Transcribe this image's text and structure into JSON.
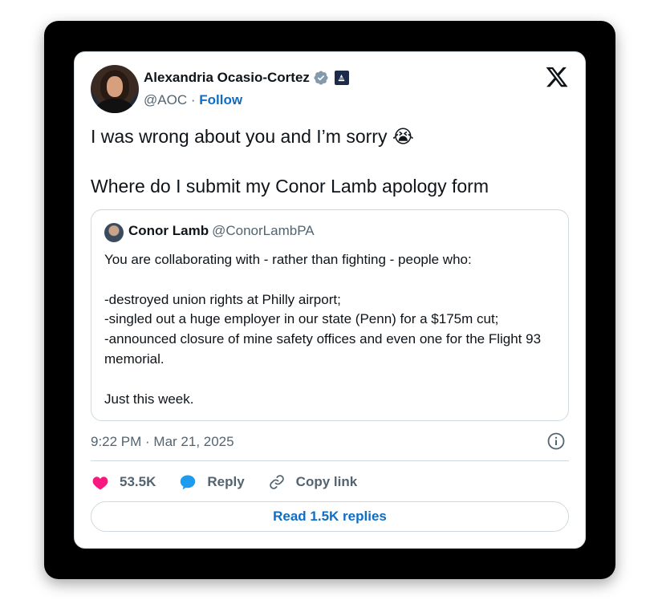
{
  "author": {
    "name": "Alexandria Ocasio-Cortez",
    "handle": "@AOC",
    "separator": "·",
    "follow_label": "Follow"
  },
  "tweet": {
    "text": "I was wrong about you and I’m sorry 😭\n\nWhere do I submit my Conor Lamb apology form"
  },
  "quoted": {
    "name": "Conor Lamb",
    "handle": "@ConorLambPA",
    "text": "You are collaborating with - rather than fighting - people who:\n\n-destroyed union rights at Philly airport;\n-singled out a huge employer in our state (Penn) for a $175m cut;\n-announced closure of mine safety offices and even one for the Flight 93 memorial.\n\nJust this week."
  },
  "timestamp": "9:22 PM · Mar 21, 2025",
  "actions": {
    "likes": "53.5K",
    "reply_label": "Reply",
    "copy_link_label": "Copy link"
  },
  "read_replies_label": "Read 1.5K replies",
  "icons": {
    "verified": "verified-badge-icon",
    "gov": "government-badge-icon",
    "x_logo": "x-logo-icon",
    "info": "info-icon",
    "heart": "heart-icon",
    "reply": "reply-bubble-icon",
    "link": "link-icon"
  },
  "colors": {
    "heart": "#f91880",
    "reply": "#1d9bf0",
    "link_blue": "#0f6ec4",
    "verified": "#829aab"
  }
}
